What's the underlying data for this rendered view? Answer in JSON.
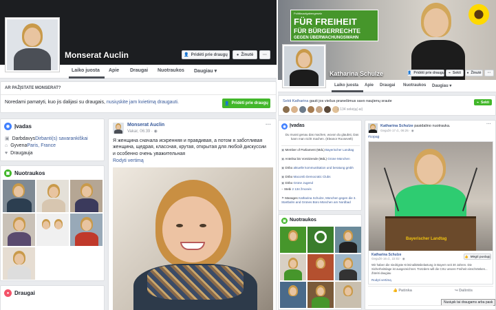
{
  "left": {
    "profile_name": "Monserat Auclin",
    "cover_buttons": {
      "add_friend": "Pridėti prie draugų",
      "message": "Žinutė",
      "more": "···"
    },
    "tabs": [
      "Laiko juosta",
      "Apie",
      "Draugai",
      "Nuotraukos",
      "Daugiau"
    ],
    "know_prompt": "AR PAŽĮSTATE MONSERAT?",
    "share_text": "Noredami pamatyti, kuo jis dalijasi su draugais, ",
    "share_link": "nusiųskite jam kvietimą draugauti.",
    "add_friend_btn": "Pridėti prie draugų",
    "intro": {
      "title": "Įvadas",
      "rows": [
        {
          "prefix": "Darbdavys ",
          "link": "Dirbanti(s) savarankiškai",
          "suffix": ""
        },
        {
          "prefix": "Gyvena ",
          "link": "Paris, France",
          "suffix": ""
        },
        {
          "prefix": "Draugauja",
          "link": "",
          "suffix": ""
        }
      ]
    },
    "photos_title": "Nuotraukos",
    "friends_title": "Draugai",
    "post": {
      "author": "Monserat Auclin",
      "time": "Vakar, 06:39 · ",
      "text": "Я женщина сначала искренняя и правдивая, а потом я заботливая женщина, щедрая, классная, крутая, открытая для любой дискуссии и особенно очень уважительная",
      "translate": "Rodyti vertimą",
      "more": "···"
    }
  },
  "right": {
    "banner": {
      "small": "Politiksaufgabengesetz",
      "line1": "FÜR FREIHEIT",
      "line2": "FÜR BÜRGERRECHTE",
      "line3": "GEGEN ÜBERWACHUNGSWAHN"
    },
    "profile_name": "Katharina Schulze",
    "cover_buttons": {
      "add_friend": "Pridėti prie draugų",
      "follow": "Sekti",
      "message": "Žinutė",
      "more": "···"
    },
    "tabs": [
      "Laiko juosta",
      "Apie",
      "Draugai",
      "Nuotraukos",
      "Daugiau"
    ],
    "follow_prompt_pre": "Sekti ",
    "follow_prompt_name": "Katharina",
    "follow_prompt_post": " gauti jos viešus pranešimus savo naujienų sraute",
    "follow_btn": "Sekti",
    "followers": "2 134 sekėjų(-ai)",
    "intro": {
      "title": "Įvadas",
      "quote": "Du musst genau das machen, wovon du glaubst, Das kann man nicht machen. (Eleanor Roosevelt)",
      "rows": [
        {
          "text": "Member of Parliament (MdL) ",
          "link": "Bayerischer Landtag"
        },
        {
          "text": "Anteilsa bis Vorsitzende (MdL) ",
          "link": "Grüne München"
        },
        {
          "text": "Dirbo ",
          "link": "aktuelle kommunikation und beratung gmbh"
        },
        {
          "text": "Dirbo ",
          "link": "Macomb Democratic Clubs"
        },
        {
          "text": "Dirbo ",
          "link": "Grüne Jugend"
        },
        {
          "text": "Stebi ",
          "link": "2 134 žmonės"
        },
        {
          "text": "Manages ",
          "link": "Katharina Schulze, München gegen die 3. Startbahn and Grünes Büro München am Nordbad"
        }
      ]
    },
    "photos_title": "Nuotraukos",
    "post": {
      "author": "Katharina Schulze",
      "action": " pasidalino nuotrauka.",
      "time": "Gegužė 17 d., 06:25 · ",
      "hashtag": "#copag",
      "more": "···",
      "inner_author": "Katharina Schulze",
      "inner_time": "Gegužė 16 d., 22:02 · ",
      "inner_follow": "Mėgti puslapį",
      "inner_text": "Wir haben die niedrigste Kriminalitätsbelastung in Bayern seit 30 Jahren. Die Sicherheitslage ist ausgezeichnet. Trotzdem will die CSU unsere Freiheit einschränken... Žiūrėti daugiau",
      "inner_translate": "Rodyti vertimą",
      "podium_text": "Bayerischer Landtag",
      "like": "Patinka",
      "comment": "Dalintis",
      "tooltip": "Nusiųsk tai draugams arba pask"
    }
  },
  "colors": {
    "link": "#365899",
    "green": "#42b72a",
    "grune_green": "#46962b",
    "sunflower": "#ffd900",
    "fb_bg": "#e9ebee"
  }
}
